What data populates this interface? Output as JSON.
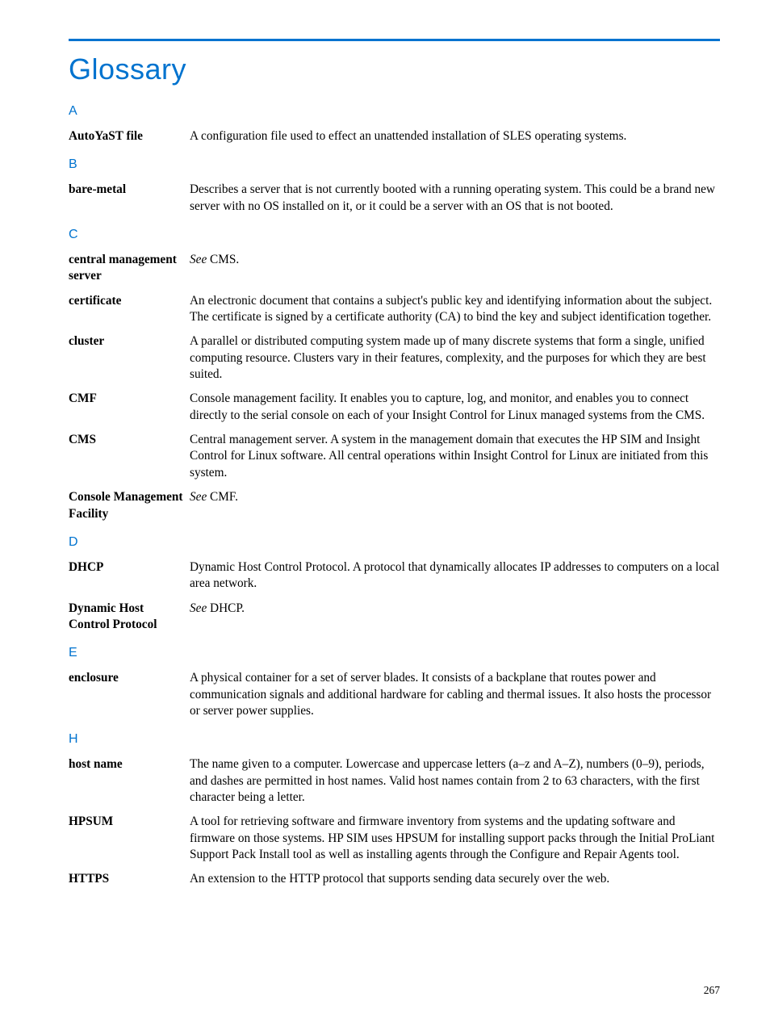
{
  "title": "Glossary",
  "page_number": "267",
  "sections": [
    {
      "letter": "A",
      "entries": [
        {
          "term": "AutoYaST file",
          "def": "A configuration file used to effect an unattended installation of SLES operating systems."
        }
      ]
    },
    {
      "letter": "B",
      "entries": [
        {
          "term": "bare-metal",
          "def": "Describes a server that is not currently booted with a running operating system. This could be a brand new server with no OS installed on it, or it could be a server with an OS that is not booted."
        }
      ]
    },
    {
      "letter": "C",
      "entries": [
        {
          "term": "central management server",
          "see": "See",
          "ref": " CMS."
        },
        {
          "term": "certificate",
          "def": "An electronic document that contains a subject's public key and identifying information about the subject. The certificate is signed by a certificate authority (CA) to bind the key and subject identification together."
        },
        {
          "term": "cluster",
          "def": "A parallel or distributed computing system made up of many discrete systems that form a single, unified computing resource. Clusters vary in their features, complexity, and the purposes for which they are best suited."
        },
        {
          "term": "CMF",
          "def": "Console management facility. It enables you to capture, log, and monitor, and enables you to connect directly to the serial console on each of your Insight Control for Linux managed systems from the CMS."
        },
        {
          "term": "CMS",
          "def": "Central management server. A system in the management domain that executes the HP SIM and Insight Control for Linux software. All central operations within Insight Control for Linux are initiated from this system."
        },
        {
          "term": "Console Management Facility",
          "see": "See",
          "ref": " CMF."
        }
      ]
    },
    {
      "letter": "D",
      "entries": [
        {
          "term": "DHCP",
          "def": "Dynamic Host Control Protocol. A protocol that dynamically allocates IP addresses to computers on a local area network."
        },
        {
          "term": "Dynamic Host Control Protocol",
          "see": "See",
          "ref": " DHCP."
        }
      ]
    },
    {
      "letter": "E",
      "entries": [
        {
          "term": "enclosure",
          "def": "A physical container for a set of server blades. It consists of a backplane that routes power and communication signals and additional hardware for cabling and thermal issues. It also hosts the processor or server power supplies."
        }
      ]
    },
    {
      "letter": "H",
      "entries": [
        {
          "term": "host name",
          "def": "The name given to a computer. Lowercase and uppercase letters (a–z and A–Z), numbers (0–9), periods, and dashes are permitted in host names. Valid host names contain from 2 to 63 characters, with the first character being a letter."
        },
        {
          "term": "HPSUM",
          "def": "A tool for retrieving software and firmware inventory from systems and the updating software and firmware on those systems. HP SIM uses HPSUM for installing support packs through the Initial ProLiant Support Pack Install tool as well as installing agents through the Configure and Repair Agents tool."
        },
        {
          "term": "HTTPS",
          "def": "An extension to the HTTP protocol that supports sending data securely over the web."
        }
      ]
    }
  ]
}
